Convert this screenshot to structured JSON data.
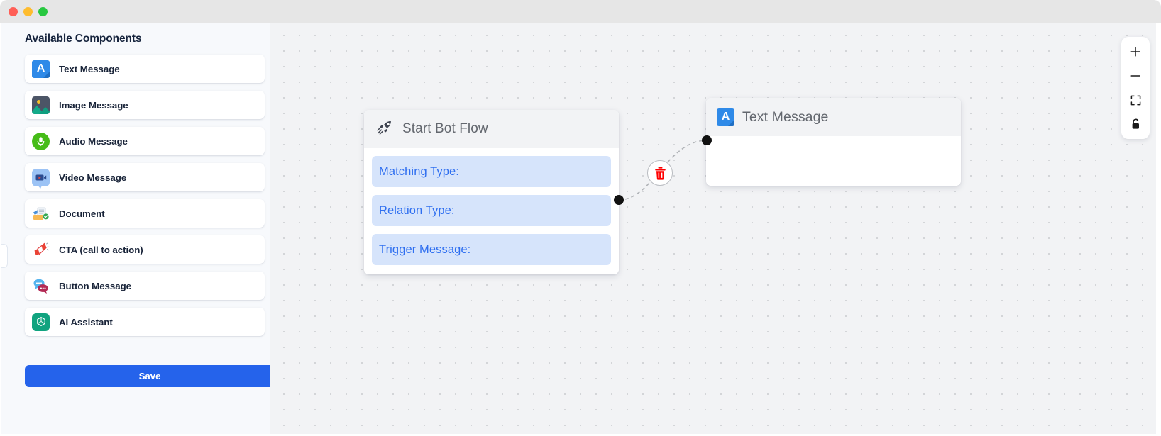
{
  "window": {
    "traffic_lights": [
      {
        "name": "close",
        "color": "#ff5f57"
      },
      {
        "name": "minimize",
        "color": "#febc2e"
      },
      {
        "name": "maximize",
        "color": "#28c840"
      }
    ]
  },
  "sidebar": {
    "title": "Available Components",
    "items": [
      {
        "label": "Text Message",
        "icon": "text-message-icon"
      },
      {
        "label": "Image Message",
        "icon": "image-message-icon"
      },
      {
        "label": "Audio Message",
        "icon": "audio-message-icon"
      },
      {
        "label": "Video Message",
        "icon": "video-message-icon"
      },
      {
        "label": "Document",
        "icon": "document-icon"
      },
      {
        "label": "CTA (call to action)",
        "icon": "megaphone-icon"
      },
      {
        "label": "Button Message",
        "icon": "chat-bubbles-icon"
      },
      {
        "label": "AI Assistant",
        "icon": "ai-assistant-icon"
      }
    ],
    "save_label": "Save",
    "collapse_handle": "collapse-sidebar-handle"
  },
  "canvas": {
    "nodes": [
      {
        "id": "start-bot-flow",
        "icon": "rocket-icon",
        "title": "Start Bot Flow",
        "fields": [
          {
            "label": "Matching Type:",
            "value": ""
          },
          {
            "label": "Relation Type:",
            "value": ""
          },
          {
            "label": "Trigger Message:",
            "value": ""
          }
        ]
      },
      {
        "id": "text-message",
        "icon": "text-message-icon",
        "title": "Text Message",
        "fields": []
      }
    ],
    "edge": {
      "delete_icon": "trash-icon",
      "style": "dashed",
      "source_handle": "start-bot-flow-source",
      "target_handle": "text-message-target"
    },
    "controls": [
      {
        "name": "zoom-in-button",
        "icon": "plus-icon"
      },
      {
        "name": "zoom-out-button",
        "icon": "minus-icon"
      },
      {
        "name": "fit-view-button",
        "icon": "fit-screen-icon"
      },
      {
        "name": "lock-button",
        "icon": "lock-icon"
      }
    ]
  },
  "colors": {
    "accent": "#2563eb",
    "field_bg": "#d6e4fb",
    "field_text": "#2f6ff0",
    "canvas_bg": "#f2f3f5",
    "sidebar_bg": "#f7f9fc",
    "danger": "#ff0000"
  }
}
